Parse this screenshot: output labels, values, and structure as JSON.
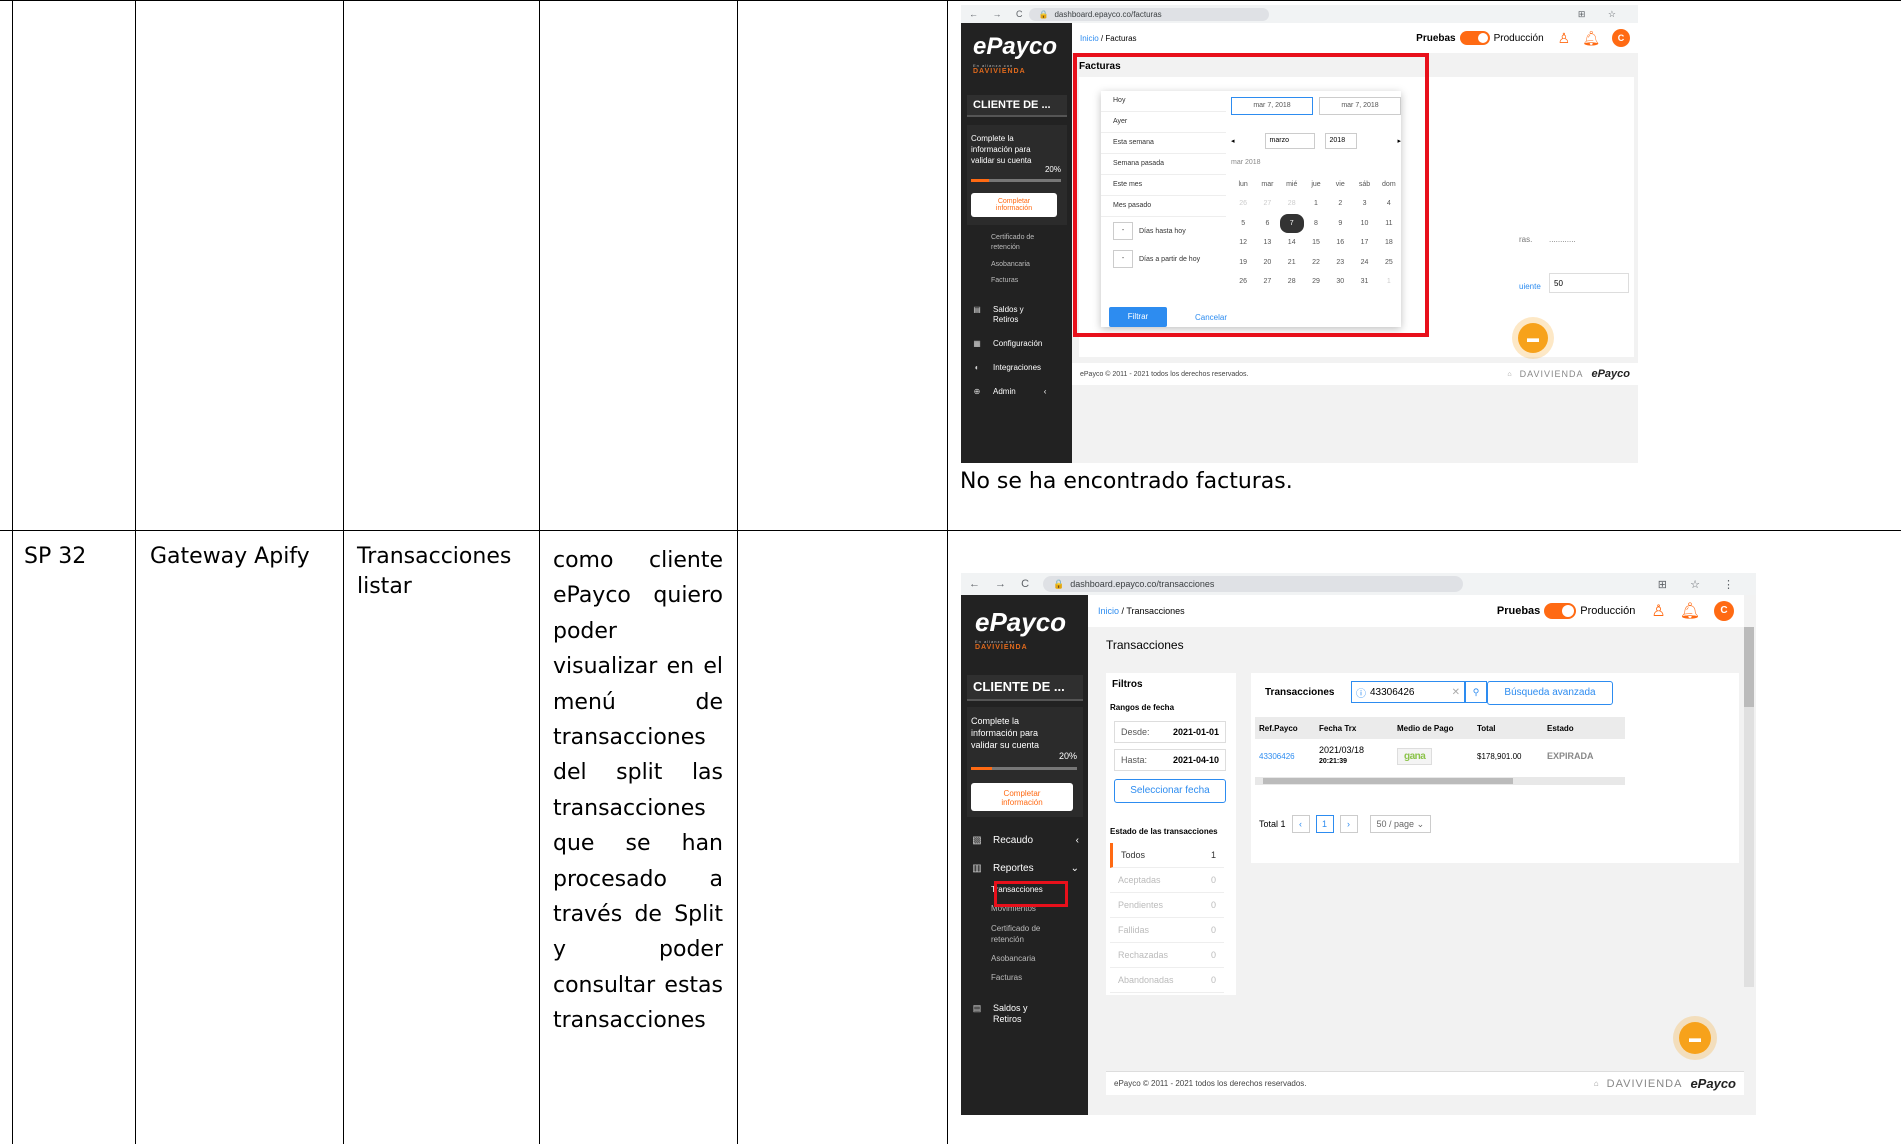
{
  "table": {
    "row2": {
      "id": "SP 32",
      "module": "Gateway Apify",
      "feature": "Transacciones listar",
      "requirement": "como cliente ePayco quiero poder visualizar en el menú de transacciones del split las transacciones que se han procesado a través de Split y poder consultar estas transacciones"
    },
    "row1_note": "No se ha encontrado facturas."
  },
  "shot1": {
    "url": "dashboard.epayco.co/facturas",
    "brand": "ePayco",
    "brand_sub_small": "En alianza con",
    "brand_sub": "DAVIVIENDA",
    "breadcrumb_home": "Inicio",
    "breadcrumb_sep": "/",
    "breadcrumb_page": "Facturas",
    "mode_test": "Pruebas",
    "mode_prod": "Producción",
    "avatar": "C",
    "client": "CLIENTE DE ...",
    "complete_text": "Complete la información para validar su cuenta",
    "complete_pct": "20%",
    "complete_btn": "Completar información",
    "submenu": [
      "Certificado de retención",
      "Asobancaria",
      "Facturas"
    ],
    "menu": [
      "Saldos y Retiros",
      "Configuración",
      "Integraciones",
      "Admin"
    ],
    "page_title": "Facturas",
    "ranges": [
      "Hoy",
      "Ayer",
      "Esta semana",
      "Semana pasada",
      "Este mes",
      "Mes pasado"
    ],
    "days_until": "Días hasta hoy",
    "days_from": "Días a partir de hoy",
    "dash": "-",
    "date_from": "mar 7, 2018",
    "date_to": "mar 7, 2018",
    "month": "marzo",
    "year": "2018",
    "month_label": "mar 2018",
    "weekdays": [
      "lun",
      "mar",
      "mié",
      "jue",
      "vie",
      "sáb",
      "dom"
    ],
    "days": [
      "26",
      "27",
      "28",
      "1",
      "2",
      "3",
      "4",
      "5",
      "6",
      "7",
      "8",
      "9",
      "10",
      "11",
      "12",
      "13",
      "14",
      "15",
      "16",
      "17",
      "18",
      "19",
      "20",
      "21",
      "22",
      "23",
      "24",
      "25",
      "26",
      "27",
      "28",
      "29",
      "30",
      "31",
      "1"
    ],
    "selected_day": "7",
    "filter_btn": "Filtrar",
    "cancel_btn": "Cancelar",
    "behind_text": "ras.",
    "behind_next": "uiente",
    "behind_page": "50",
    "footer": "ePayco © 2011 - 2021 todos los derechos reservados.",
    "footer_brand1": "DAVIVIENDA",
    "footer_brand2": "ePayco"
  },
  "shot2": {
    "url": "dashboard.epayco.co/transacciones",
    "brand": "ePayco",
    "brand_sub_small": "En alianza con",
    "brand_sub": "DAVIVIENDA",
    "breadcrumb_home": "Inicio",
    "breadcrumb_sep": "/",
    "breadcrumb_page": "Transacciones",
    "mode_test": "Pruebas",
    "mode_prod": "Producción",
    "avatar": "C",
    "client": "CLIENTE DE ...",
    "complete_text": "Complete la información para validar su cuenta",
    "complete_pct": "20%",
    "complete_btn": "Completar información",
    "menu_recaudo": "Recaudo",
    "menu_reportes": "Reportes",
    "submenu": [
      "Transacciones",
      "Movimientos",
      "Certificado de retención",
      "Asobancaria",
      "Facturas"
    ],
    "menu_saldos": "Saldos y Retiros",
    "page_title": "Transacciones",
    "filters_title": "Filtros",
    "range_title": "Rangos de fecha",
    "from_label": "Desde:",
    "from_value": "2021-01-01",
    "to_label": "Hasta:",
    "to_value": "2021-04-10",
    "select_date_btn": "Seleccionar fecha",
    "status_title": "Estado de las transacciones",
    "statuses": [
      {
        "label": "Todos",
        "count": "1"
      },
      {
        "label": "Aceptadas",
        "count": "0"
      },
      {
        "label": "Pendientes",
        "count": "0"
      },
      {
        "label": "Fallidas",
        "count": "0"
      },
      {
        "label": "Rechazadas",
        "count": "0"
      },
      {
        "label": "Abandonadas",
        "count": "0"
      }
    ],
    "tx_title": "Transacciones",
    "search_value": "43306426",
    "advanced_btn": "Búsqueda avanzada",
    "columns": [
      "Ref.Payco",
      "Fecha Trx",
      "Medio de Pago",
      "Total",
      "Estado"
    ],
    "row": {
      "ref": "43306426",
      "date": "2021/03/18",
      "time": "20:21:39",
      "method": "gana",
      "total": "$178,901.00",
      "status": "EXPIRADA"
    },
    "total_label": "Total 1",
    "page": "1",
    "per_page": "50 / page",
    "footer": "ePayco © 2011 - 2021 todos los derechos reservados.",
    "footer_brand1": "DAVIVIENDA",
    "footer_brand2": "ePayco"
  },
  "colors": {
    "brand_orange": "#ff6a13",
    "highlight_red": "#e8101b",
    "link_blue": "#2d8cf0",
    "sidebar_dark": "#222222"
  }
}
